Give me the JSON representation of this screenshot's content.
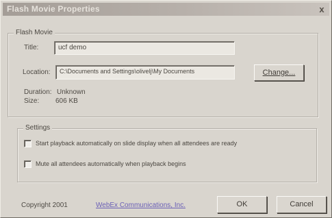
{
  "window": {
    "title": "Flash Movie Properties",
    "close_symbol": "x"
  },
  "flash_movie": {
    "group_label": "Flash Movie",
    "title_label": "Title:",
    "title_value": "ucf demo",
    "location_label": "Location:",
    "location_value": "C:\\Documents and Settings\\olivelj\\My Documents",
    "change_button": "Change...",
    "duration_label": "Duration:",
    "duration_value": "Unknown",
    "size_label": "Size:",
    "size_value": "606 KB"
  },
  "settings": {
    "group_label": "Settings",
    "checkboxes": [
      {
        "label": "Start playback automatically on slide display when all attendees are ready",
        "checked": false
      },
      {
        "label": "Mute all attendees automatically when playback begins",
        "checked": false
      }
    ]
  },
  "footer": {
    "copyright": "Copyright 2001",
    "company_link": "WebEx Communications, Inc.",
    "ok_button": "OK",
    "cancel_button": "Cancel"
  },
  "colors": {
    "titlebar_start": "#a49d97",
    "link": "#6a5fb6",
    "dialog_bg": "#d9d5ce"
  }
}
